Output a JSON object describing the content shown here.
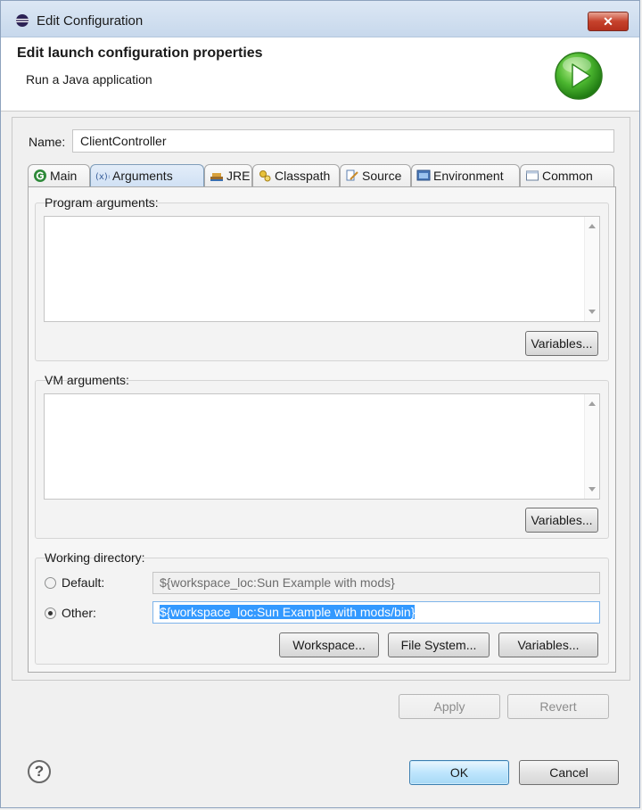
{
  "window": {
    "title": "Edit Configuration",
    "close_glyph": "✕"
  },
  "header": {
    "title": "Edit launch configuration properties",
    "subtitle": "Run a Java application",
    "icon": "run-icon"
  },
  "name": {
    "label": "Name:",
    "value": "ClientController"
  },
  "tabs": [
    {
      "label": "Main",
      "icon": "main-tab-icon",
      "active": false
    },
    {
      "label": "Arguments",
      "icon": "arguments-tab-icon",
      "active": true
    },
    {
      "label": "JRE",
      "icon": "jre-tab-icon",
      "active": false
    },
    {
      "label": "Classpath",
      "icon": "classpath-tab-icon",
      "active": false
    },
    {
      "label": "Source",
      "icon": "source-tab-icon",
      "active": false
    },
    {
      "label": "Environment",
      "icon": "environment-tab-icon",
      "active": false
    },
    {
      "label": "Common",
      "icon": "common-tab-icon",
      "active": false
    }
  ],
  "arguments": {
    "program_label": "Program arguments:",
    "program_value": "",
    "program_variables": "Variables...",
    "vm_label": "VM arguments:",
    "vm_value": "",
    "vm_variables": "Variables..."
  },
  "working_dir": {
    "label": "Working directory:",
    "default_label": "Default:",
    "default_value": "${workspace_loc:Sun Example with mods}",
    "other_label": "Other:",
    "other_value": "${workspace_loc:Sun Example with mods/bin}",
    "selected": "other",
    "workspace_btn": "Workspace...",
    "filesystem_btn": "File System...",
    "variables_btn": "Variables..."
  },
  "actions": {
    "apply": "Apply",
    "revert": "Revert",
    "ok": "OK",
    "cancel": "Cancel",
    "help_glyph": "?"
  },
  "colors": {
    "selection": "#3399ff",
    "run_icon": "#3fae2a"
  }
}
